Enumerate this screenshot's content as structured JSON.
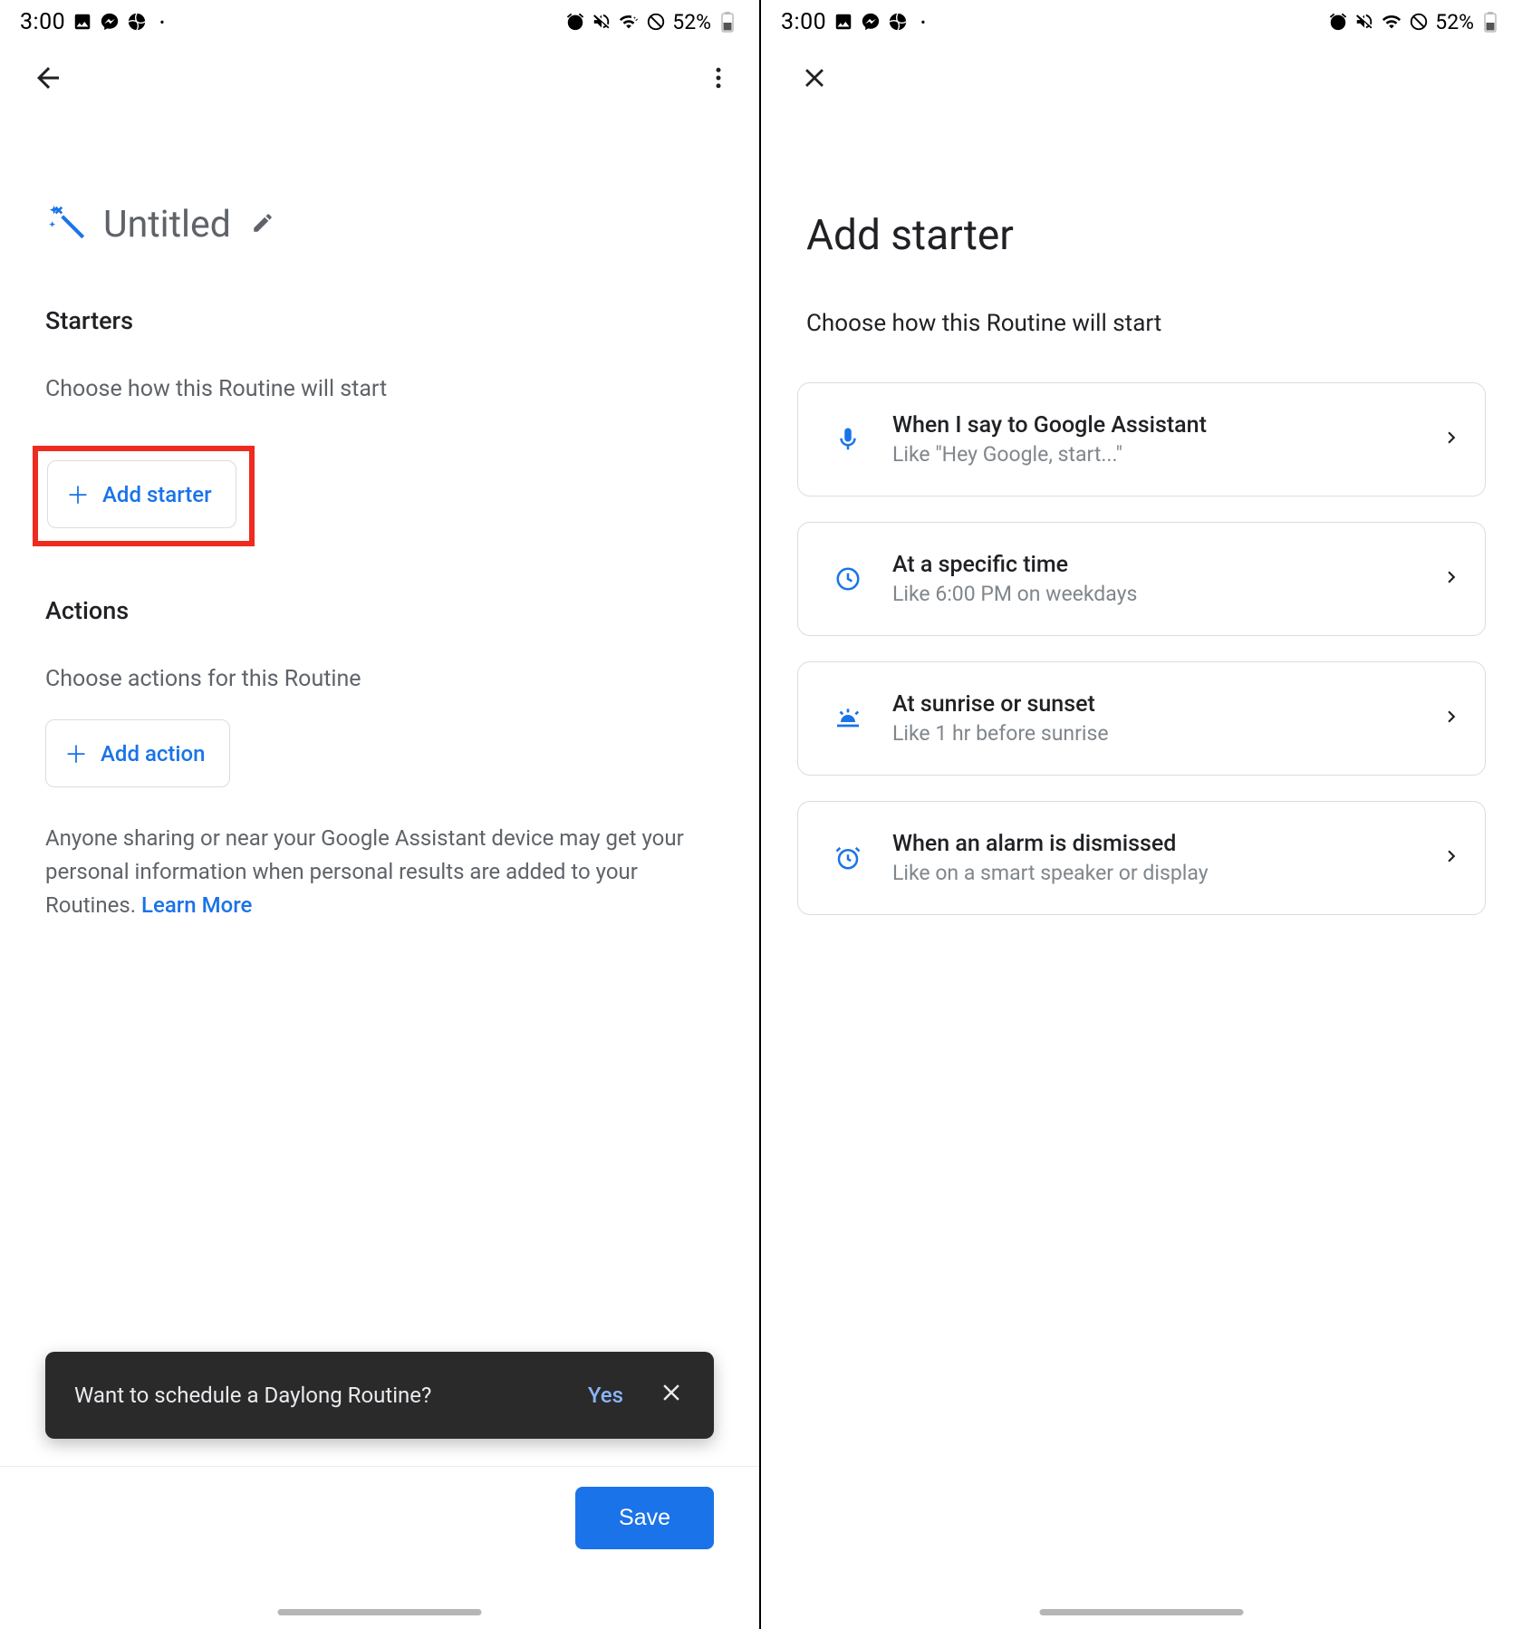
{
  "status": {
    "time": "3:00",
    "battery": "52%"
  },
  "left": {
    "title": "Untitled",
    "starters_heading": "Starters",
    "starters_sub": "Choose how this Routine will start",
    "add_starter_label": "Add starter",
    "actions_heading": "Actions",
    "actions_sub": "Choose actions for this Routine",
    "add_action_label": "Add action",
    "info_text": "Anyone sharing or near your Google Assistant device may get your personal information when personal results are added to your Routines. ",
    "learn_more": "Learn More",
    "snackbar_msg": "Want to schedule a Daylong Routine?",
    "snackbar_yes": "Yes",
    "save": "Save"
  },
  "right": {
    "title": "Add starter",
    "sub": "Choose how this Routine will start",
    "options": [
      {
        "title": "When I say to Google Assistant",
        "desc": "Like \"Hey Google, start...\""
      },
      {
        "title": "At a specific time",
        "desc": "Like 6:00 PM on weekdays"
      },
      {
        "title": "At sunrise or sunset",
        "desc": "Like 1 hr before sunrise"
      },
      {
        "title": "When an alarm is dismissed",
        "desc": "Like on a smart speaker or display"
      }
    ]
  }
}
